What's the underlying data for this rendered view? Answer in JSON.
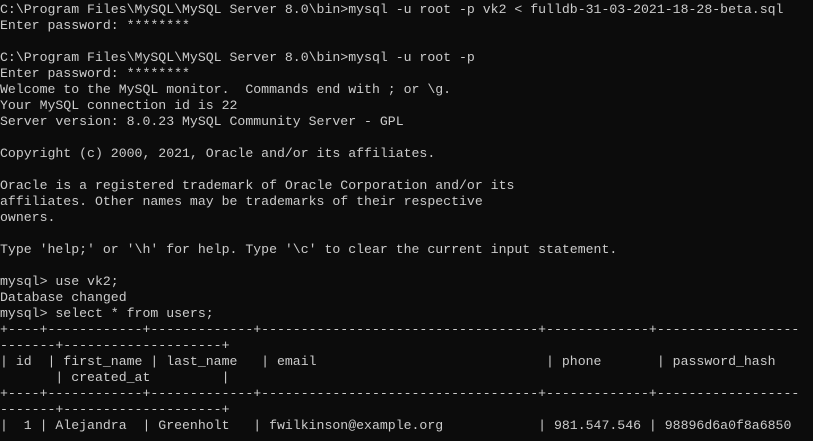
{
  "terminal": {
    "lines": [
      "C:\\Program Files\\MySQL\\MySQL Server 8.0\\bin>mysql -u root -p vk2 < fulldb-31-03-2021-18-28-beta.sql",
      "Enter password: ********",
      "",
      "C:\\Program Files\\MySQL\\MySQL Server 8.0\\bin>mysql -u root -p",
      "Enter password: ********",
      "Welcome to the MySQL monitor.  Commands end with ; or \\g.",
      "Your MySQL connection id is 22",
      "Server version: 8.0.23 MySQL Community Server - GPL",
      "",
      "Copyright (c) 2000, 2021, Oracle and/or its affiliates.",
      "",
      "Oracle is a registered trademark of Oracle Corporation and/or its",
      "affiliates. Other names may be trademarks of their respective",
      "owners.",
      "",
      "Type 'help;' or '\\h' for help. Type '\\c' to clear the current input statement.",
      "",
      "mysql> use vk2;",
      "Database changed",
      "mysql> select * from users;",
      "+----+------------+-------------+-----------------------------------+-------------+------------------",
      "-------+--------------------+",
      "| id  | first_name | last_name   | email                             | phone       | password_hash",
      "       | created_at         |",
      "+----+------------+-------------+-----------------------------------+-------------+------------------",
      "-------+--------------------+",
      "|  1 | Alejandra  | Greenholt   | fwilkinson@example.org            | 981.547.546 | 98896d6a0f8a6850"
    ]
  }
}
